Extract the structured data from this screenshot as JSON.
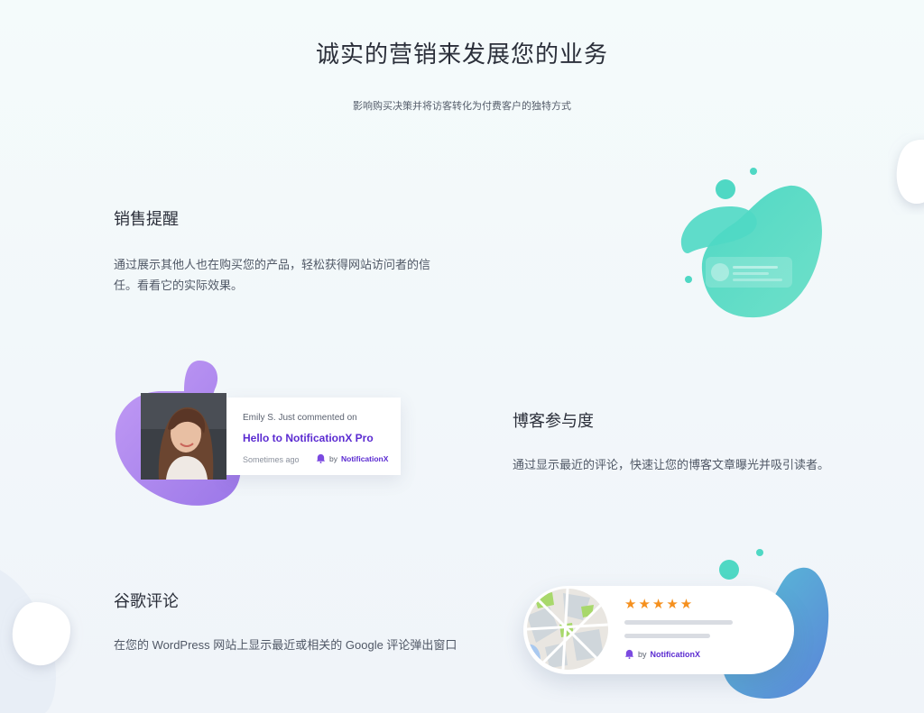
{
  "hero": {
    "title": "诚实的营销来发展您的业务",
    "subtitle": "影响购买决策并将访客转化为付费客户的独特方式"
  },
  "features": [
    {
      "title": "销售提醒",
      "description": "通过展示其他人也在购买您的产品，轻松获得网站访问者的信任。看看它的实际效果。"
    },
    {
      "title": "博客参与度",
      "description": "通过显示最近的评论，快速让您的博客文章曝光并吸引读者。"
    },
    {
      "title": "谷歌评论",
      "description": "在您的 WordPress 网站上显示最近或相关的 Google 评论弹出窗口"
    }
  ],
  "comment_card": {
    "user_line": "Emily S. Just commented on",
    "post_title": "Hello to NotificationX Pro",
    "time": "Sometimes ago",
    "by": "by",
    "brand": "NotificationX"
  },
  "review_card": {
    "stars": "★★★★★",
    "by": "by",
    "brand": "NotificationX",
    "star_color": "#f5901e"
  },
  "colors": {
    "accent": "#5b2bd1",
    "teal": "#4fd8c4",
    "purple": "#b48cf2",
    "blue": "#5b8fd8"
  }
}
